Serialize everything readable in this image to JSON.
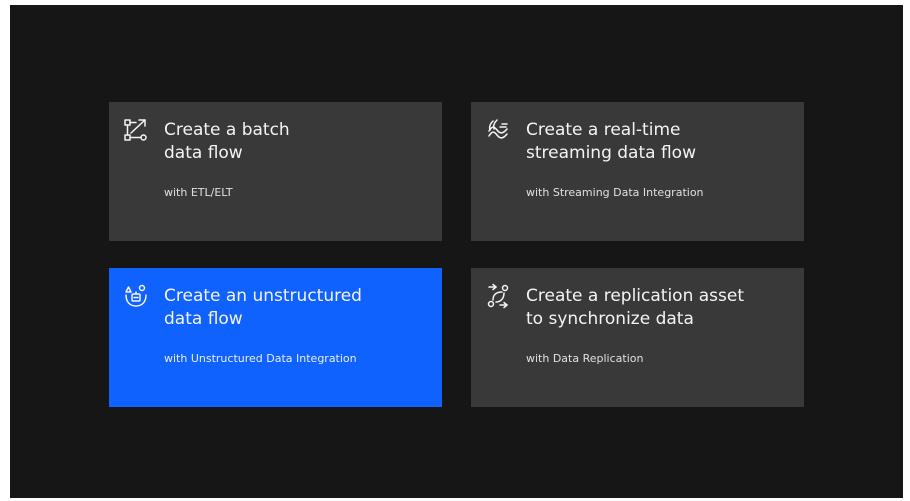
{
  "tiles": [
    {
      "title_line1": "Create a batch",
      "title_line2": "data flow",
      "subtitle": "with ETL/ELT",
      "icon": "batch-flow-icon"
    },
    {
      "title_line1": "Create a real-time",
      "title_line2": "streaming data flow",
      "subtitle": "with Streaming Data Integration",
      "icon": "streaming-icon"
    },
    {
      "title_line1": "Create an unstructured",
      "title_line2": "data flow",
      "subtitle": "with Unstructured Data Integration",
      "icon": "unstructured-data-icon",
      "selected": true
    },
    {
      "title_line1": "Create a replication asset",
      "title_line2": "to synchronize data",
      "subtitle": "with Data Replication",
      "icon": "replication-icon"
    }
  ],
  "colors": {
    "background": "#161616",
    "tile": "#393939",
    "tile_selected": "#0f62fe",
    "text": "#f4f4f4"
  }
}
